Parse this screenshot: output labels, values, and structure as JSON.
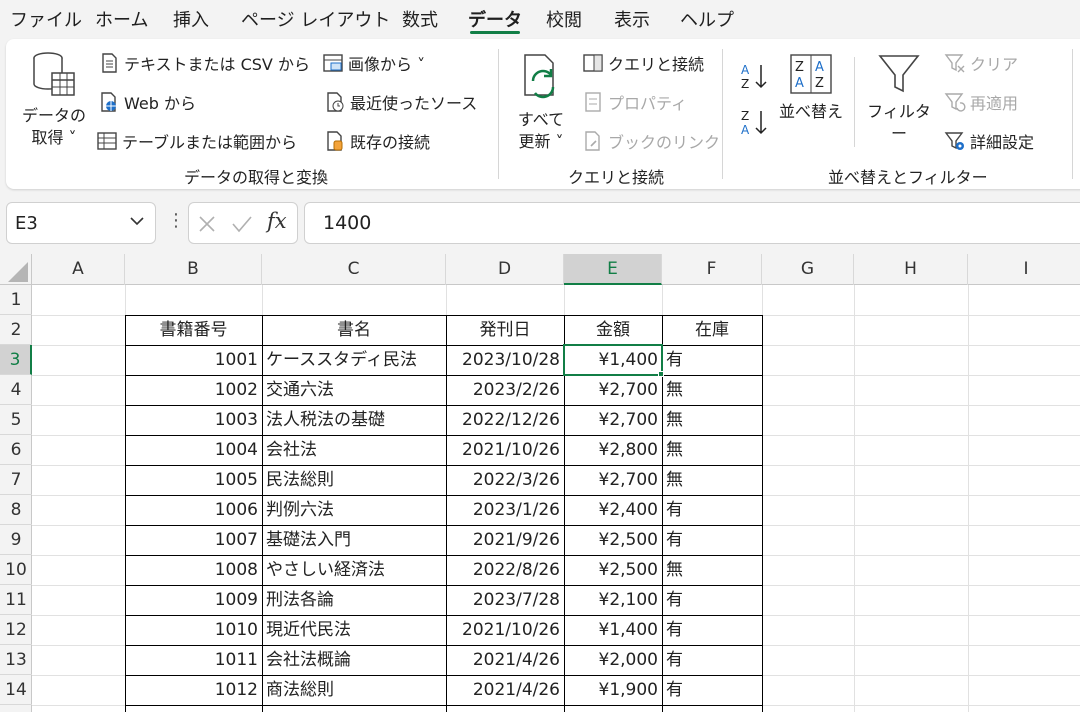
{
  "menu": {
    "tabs": [
      "ファイル",
      "ホーム",
      "挿入",
      "ページ レイアウト",
      "数式",
      "データ",
      "校閲",
      "表示",
      "ヘルプ"
    ],
    "active": "データ"
  },
  "ribbon": {
    "get_data": {
      "big_label_1": "データの",
      "big_label_2": "取得 ˅",
      "from_text_csv": "テキストまたは CSV から",
      "from_web": "Web から",
      "from_table": "テーブルまたは範囲から",
      "from_picture": "画像から ˅",
      "recent_sources": "最近使ったソース",
      "existing_connections": "既存の接続",
      "group_label": "データの取得と変換"
    },
    "queries": {
      "refresh_1": "すべて",
      "refresh_2": "更新 ˅",
      "queries_connections": "クエリと接続",
      "properties": "プロパティ",
      "workbook_links": "ブックのリンク",
      "group_label": "クエリと接続"
    },
    "sort_filter": {
      "sort": "並べ替え",
      "filter": "フィルター",
      "clear": "クリア",
      "reapply": "再適用",
      "advanced": "詳細設定",
      "group_label": "並べ替えとフィルター"
    }
  },
  "formula_bar": {
    "name_box": "E3",
    "fx": "fx",
    "value": "1400"
  },
  "columns": [
    "A",
    "B",
    "C",
    "D",
    "E",
    "F",
    "G",
    "H",
    "I"
  ],
  "selected_column": "E",
  "rows": [
    "1",
    "2",
    "3",
    "4",
    "5",
    "6",
    "7",
    "8",
    "9",
    "10",
    "11",
    "12",
    "13",
    "14"
  ],
  "selected_row": "3",
  "table": {
    "headers": [
      "書籍番号",
      "書名",
      "発刊日",
      "金額",
      "在庫"
    ],
    "records": [
      [
        "1001",
        "ケーススタディ民法",
        "2023/10/28",
        "¥1,400",
        "有"
      ],
      [
        "1002",
        "交通六法",
        "2023/2/26",
        "¥2,700",
        "無"
      ],
      [
        "1003",
        "法人税法の基礎",
        "2022/12/26",
        "¥2,700",
        "無"
      ],
      [
        "1004",
        "会社法",
        "2021/10/26",
        "¥2,800",
        "無"
      ],
      [
        "1005",
        "民法総則",
        "2022/3/26",
        "¥2,700",
        "無"
      ],
      [
        "1006",
        "判例六法",
        "2023/1/26",
        "¥2,400",
        "有"
      ],
      [
        "1007",
        "基礎法入門",
        "2021/9/26",
        "¥2,500",
        "有"
      ],
      [
        "1008",
        "やさしい経済法",
        "2022/8/26",
        "¥2,500",
        "無"
      ],
      [
        "1009",
        "刑法各論",
        "2023/7/28",
        "¥2,100",
        "有"
      ],
      [
        "1010",
        "現近代民法",
        "2021/10/26",
        "¥1,400",
        "有"
      ],
      [
        "1011",
        "会社法概論",
        "2021/4/26",
        "¥2,000",
        "有"
      ],
      [
        "1012",
        "商法総則",
        "2021/4/26",
        "¥1,900",
        "有"
      ]
    ]
  },
  "colors": {
    "accent": "#117e46",
    "disabled": "#a8a8a8"
  }
}
